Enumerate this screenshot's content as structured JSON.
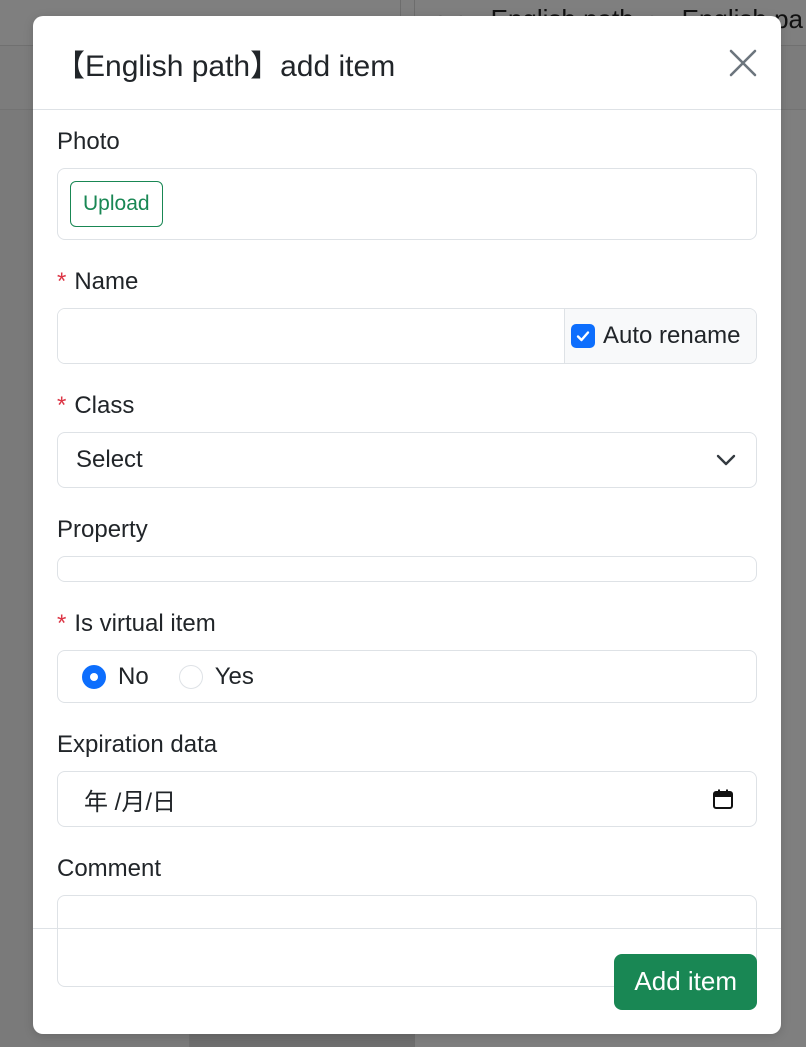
{
  "background": {
    "breadcrumb": [
      "",
      "English path",
      "English pa"
    ]
  },
  "modal": {
    "title": "【English path】add item",
    "close_icon": "close-icon",
    "photo": {
      "label": "Photo",
      "upload_label": "Upload"
    },
    "name": {
      "required_mark": "*",
      "label": "Name",
      "value": "",
      "auto_rename_label": "Auto rename",
      "auto_rename_checked": true
    },
    "class": {
      "required_mark": "*",
      "label": "Class",
      "selected": "Select",
      "icon": "chevron-down-icon"
    },
    "property": {
      "label": "Property"
    },
    "is_virtual": {
      "required_mark": "*",
      "label": "Is virtual item",
      "options": [
        {
          "label": "No",
          "selected": true
        },
        {
          "label": "Yes",
          "selected": false
        }
      ]
    },
    "expiration": {
      "label": "Expiration data",
      "placeholder": "年 /月/日",
      "icon": "calendar-icon"
    },
    "comment": {
      "label": "Comment",
      "value": ""
    },
    "footer": {
      "submit_label": "Add item"
    }
  },
  "colors": {
    "primary_blue": "#0d6efd",
    "success_green": "#198754",
    "danger_red": "#dc3545",
    "border": "#dee2e6"
  }
}
